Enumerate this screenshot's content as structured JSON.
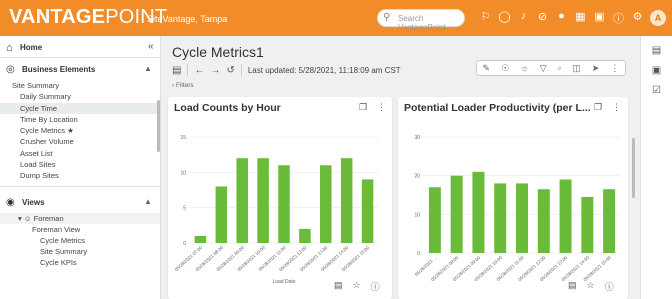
{
  "app": {
    "brand_bold": "VANTAGE",
    "brand_light": "POINT",
    "site": "SiteVantage, Tampa",
    "avatar": "A"
  },
  "search": {
    "placeholder": "Search VantagePoint"
  },
  "topbar_icons": [
    "pin-icon",
    "globe-icon",
    "bell-icon",
    "circle-slash-icon",
    "person-icon",
    "grid-icon",
    "gift-icon",
    "help-icon",
    "gear-icon"
  ],
  "sidebar": {
    "home": "Home",
    "business_elements": "Business Elements",
    "be_items": [
      "Site Summary",
      "Daily Summary",
      "Cycle Time",
      "Time By Location",
      "Cycle Metrics ★",
      "Crusher Volume",
      "Asset List",
      "Load Sites",
      "Dump Sites"
    ],
    "active_index": 2,
    "views": "Views",
    "foreman": "Foreman",
    "foreman_items": [
      "Foreman View",
      "Cycle Metrics",
      "Site Summary",
      "Cycle KPIs"
    ]
  },
  "page": {
    "title": "Cycle Metrics1",
    "last_updated": "Last updated: 5/28/2021, 11:18:09 am CST",
    "filters": "› Filters"
  },
  "chart_data": [
    {
      "type": "bar",
      "title": "Load Counts by Hour",
      "xlabel": "Load Date",
      "ylabel": "",
      "ylim": [
        0,
        15
      ],
      "yticks": [
        0,
        5,
        10,
        15
      ],
      "grid": true,
      "color": "#6abb3a",
      "categories": [
        "05/28/2021 07:00",
        "05/28/2021 08:00",
        "05/28/2021 09:00",
        "05/28/2021 10:00",
        "05/28/2021 11:00",
        "05/28/2021 12:00",
        "05/28/2021 13:00",
        "05/28/2021 14:00",
        "05/28/2021 15:00",
        "05/28/2021 16:00"
      ],
      "values": [
        1,
        8,
        12,
        12,
        11,
        2,
        11,
        12,
        9,
        0
      ],
      "plotted": 9
    },
    {
      "type": "bar",
      "title": "Potential Loader Productivity (per L...",
      "xlabel": "",
      "ylabel": "",
      "ylim": [
        0,
        30
      ],
      "yticks": [
        0,
        10,
        20,
        30
      ],
      "grid": true,
      "color": "#6abb3a",
      "categories": [
        "05/28/2021 ...",
        "05/28/2021 08:00",
        "05/28/2021 09:00",
        "05/28/2021 10:00",
        "05/28/2021 11:00",
        "05/28/2021 12:00",
        "05/28/2021 13:00",
        "05/28/2021 14:00",
        "05/28/2021 15:00"
      ],
      "values": [
        17,
        20,
        21,
        18,
        18,
        16.5,
        19,
        14.5,
        16.5
      ]
    }
  ]
}
